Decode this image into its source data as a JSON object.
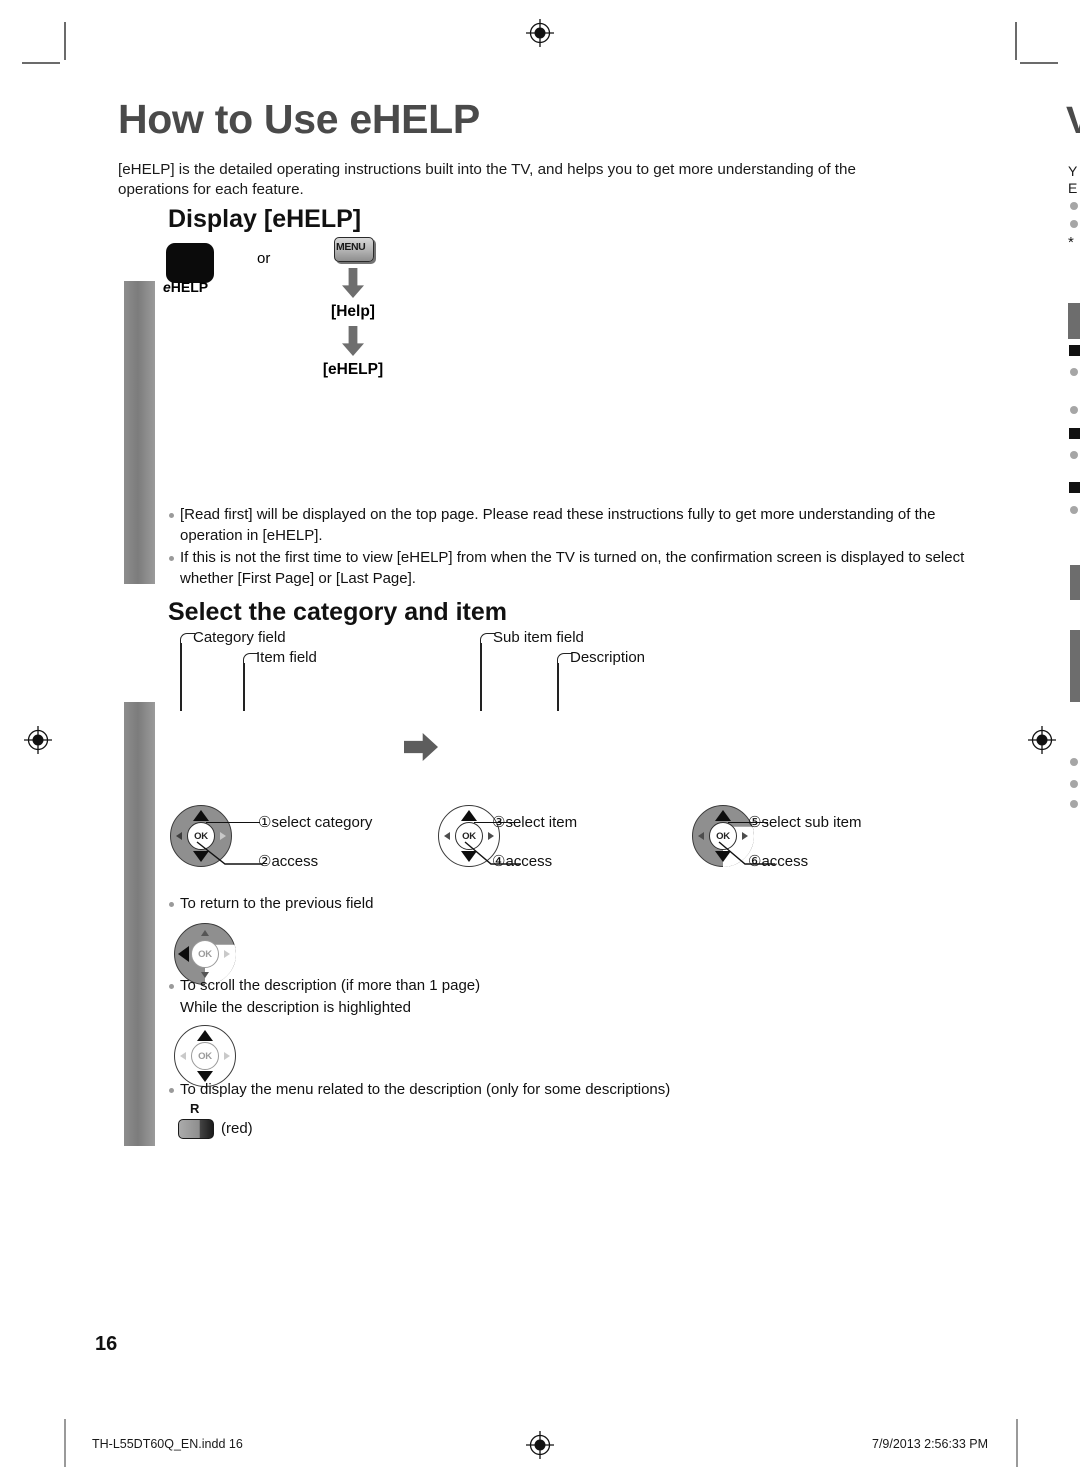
{
  "document": {
    "page_title": "How to Use eHELP",
    "page_number": "16",
    "intro": "[eHELP] is the detailed operating instructions built into the TV, and helps you to get more understanding of the operations for each feature."
  },
  "section_display": {
    "heading": "Display [eHELP]",
    "ehelp_key_label_italic": "e",
    "ehelp_key_label_rest": "HELP",
    "or_text": "or",
    "menu_key_label": "MENU",
    "flow": [
      {
        "label": "[Help]"
      },
      {
        "label": "[eHELP]"
      }
    ],
    "notes": [
      "[Read first] will be displayed on the top page. Please read these instructions fully to get more understanding of the operation in [eHELP].",
      "If this is not the first time to view [eHELP] from when the TV is turned on, the confirmation screen is displayed to select whether [First Page] or [Last Page]."
    ]
  },
  "section_select": {
    "heading": "Select the category and item",
    "callouts": [
      {
        "label": "Category field"
      },
      {
        "label": "Item field"
      },
      {
        "label": "Sub item field"
      },
      {
        "label": "Description"
      }
    ],
    "dpads": [
      {
        "ok_label": "OK",
        "steps": [
          {
            "num": "①",
            "label": "select category"
          },
          {
            "num": "②",
            "label": "access"
          }
        ]
      },
      {
        "ok_label": "OK",
        "steps": [
          {
            "num": "③",
            "label": "select item"
          },
          {
            "num": "④",
            "label": "access"
          }
        ]
      },
      {
        "ok_label": "OK",
        "steps": [
          {
            "num": "⑤",
            "label": "select sub item"
          },
          {
            "num": "⑥",
            "label": "access"
          }
        ]
      }
    ],
    "tips": [
      {
        "text": "To return to the previous field",
        "ok_label": "OK"
      },
      {
        "text": "To scroll the description (if more than 1 page)",
        "subtext": "While the description is highlighted",
        "ok_label": "OK"
      },
      {
        "text": "To display the menu related to the description (only for some descriptions)",
        "key_letter": "R",
        "key_caption": "(red)"
      }
    ]
  },
  "footer": {
    "filename": "TH-L55DT60Q_EN.indd   16",
    "timestamp": "7/9/2013   2:56:33 PM"
  },
  "bleed": {
    "title_fragment": "V",
    "line1": "Y",
    "line2": "E",
    "star": "*"
  },
  "colors": {
    "title_gray": "#4a4a4a",
    "band_gray": "#8d8d8d",
    "arrow_gray": "#6e6e6e",
    "bullet_gray": "#9a9a9a",
    "key_black": "#0b0b0b"
  }
}
